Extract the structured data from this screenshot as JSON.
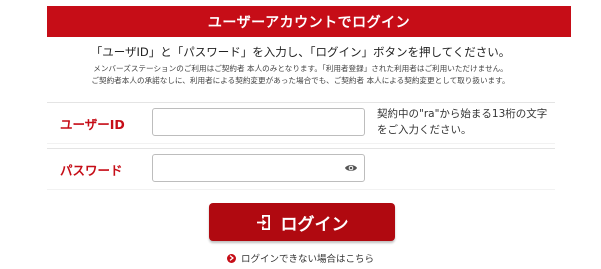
{
  "header": {
    "title": "ユーザーアカウントでログイン"
  },
  "instructions": {
    "main": "「ユーザID」と「パスワード」を入力し、「ログイン」ボタンを押してください。",
    "notice_line1": "メンバーズステーションのご利用はご契約者 本人のみとなります。「利用者登録」された利用者はご利用いただけません。",
    "notice_line2": "ご契約者本人の承諾なしに、利用者による契約変更があった場合でも、ご契約者 本人による契約変更として取り扱います。"
  },
  "form": {
    "userid": {
      "label": "ユーザーID",
      "value": "",
      "placeholder": "",
      "hint": "契約中の\"ra\"から始まる13桁の文字をご入力ください。"
    },
    "password": {
      "label": "パスワード",
      "value": "",
      "placeholder": ""
    }
  },
  "login_button": {
    "label": "ログイン",
    "icon": "login-door-icon"
  },
  "help_link": {
    "label": "ログインできない場合はこちら",
    "icon": "chevron-right-circle-icon"
  },
  "colors": {
    "brand_red": "#c60d17",
    "button_red": "#b00910"
  }
}
